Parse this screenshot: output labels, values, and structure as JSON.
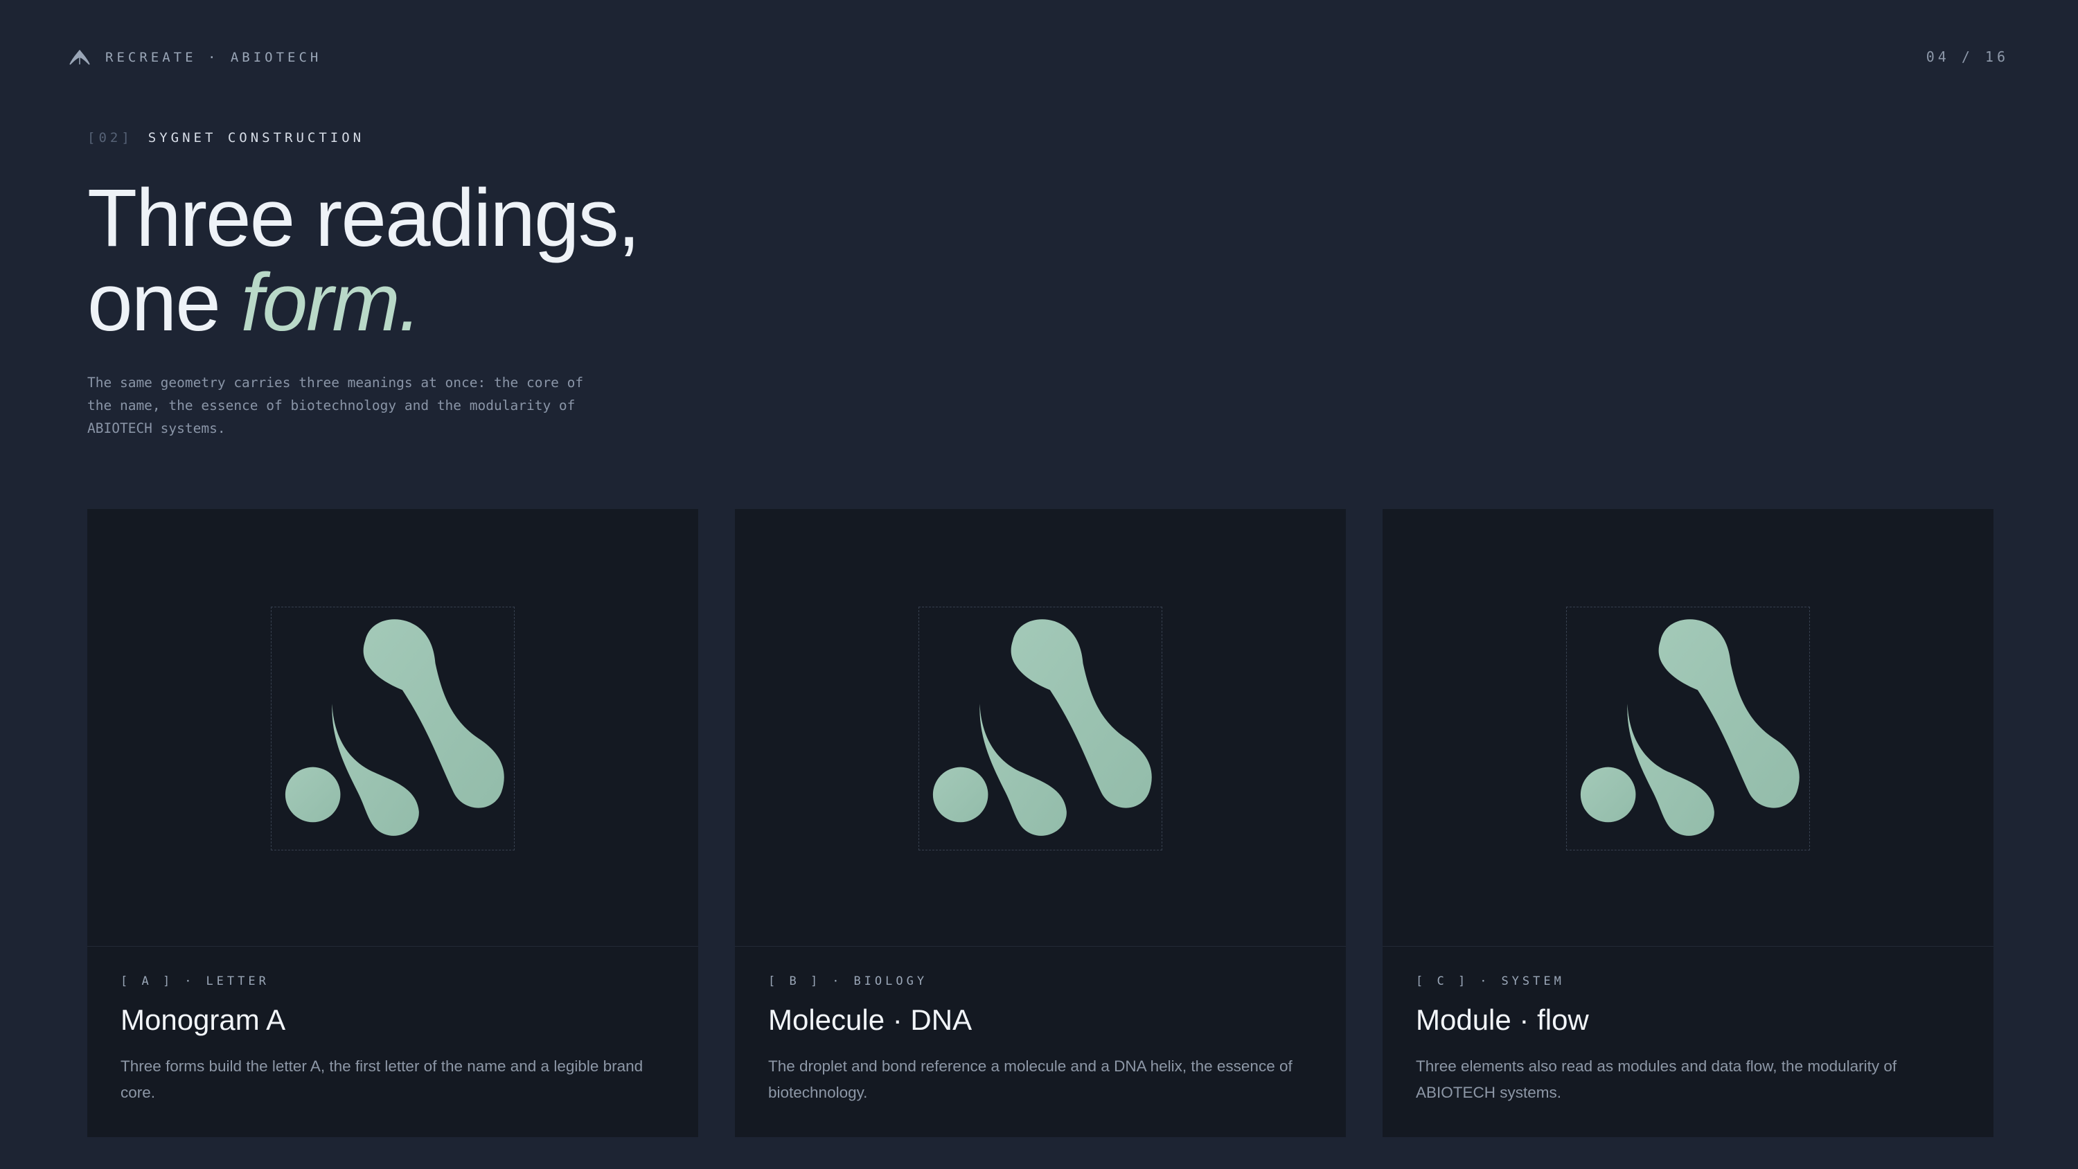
{
  "header": {
    "brand": "RECREATE · ABIOTECH",
    "brand_icon": "leaf-icon",
    "pager": "04 / 16"
  },
  "section": {
    "number": "[02]",
    "name": "SYGNET CONSTRUCTION"
  },
  "headline": {
    "line1": "Three readings,",
    "line2_plain": "one ",
    "line2_accent": "form."
  },
  "intro": "The same geometry carries three meanings at once: the core of the name, the essence of biotechnology and the modularity of ABIOTECH systems.",
  "colors": {
    "background": "#1d2433",
    "card": "#141922",
    "accent": "#b9d9c8",
    "mark": "#9cc4b2"
  },
  "cards": [
    {
      "tag_letter": "[ A ]",
      "tag_sep": "·",
      "tag_word": "LETTER",
      "title": "Monogram A",
      "description": "Three forms build the letter A, the first letter of the name and a legible brand core.",
      "icon": "abiotech-sygnet-icon"
    },
    {
      "tag_letter": "[ B ]",
      "tag_sep": "·",
      "tag_word": "BIOLOGY",
      "title": "Molecule · DNA",
      "description": "The droplet and bond reference a molecule and a DNA helix, the essence of biotechnology.",
      "icon": "abiotech-sygnet-icon"
    },
    {
      "tag_letter": "[ C ]",
      "tag_sep": "·",
      "tag_word": "SYSTEM",
      "title": "Module · flow",
      "description": "Three elements also read as modules and data flow, the modularity of ABIOTECH systems.",
      "icon": "abiotech-sygnet-icon"
    }
  ]
}
